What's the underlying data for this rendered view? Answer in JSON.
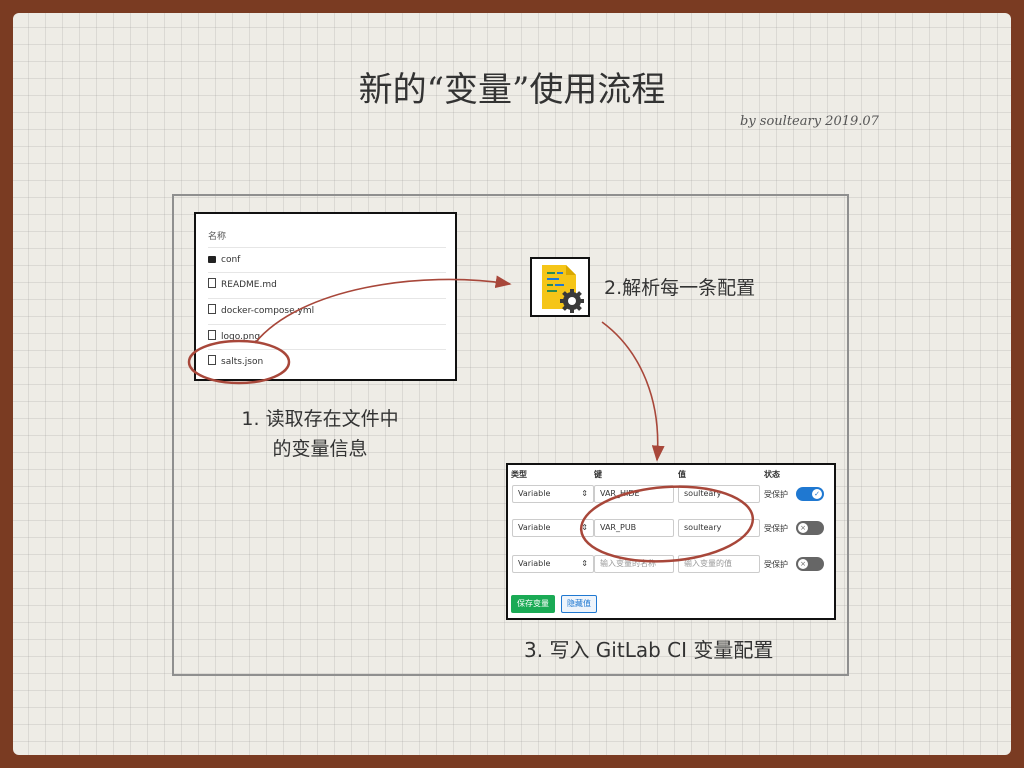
{
  "slide": {
    "title": "新的“变量”使用流程",
    "byline": "by soulteary 2019.07"
  },
  "files": {
    "header": "名称",
    "items": [
      {
        "name": "conf",
        "icon": "folder-icon"
      },
      {
        "name": "README.md",
        "icon": "file-icon"
      },
      {
        "name": "docker-compose.yml",
        "icon": "file-icon"
      },
      {
        "name": "logo.png",
        "icon": "file-icon"
      },
      {
        "name": "salts.json",
        "icon": "file-icon"
      }
    ]
  },
  "steps": {
    "step1_line1": "1. 读取存在文件中",
    "step1_line2": "的变量信息",
    "step2": "2.解析每一条配置",
    "step3": "3. 写入 GitLab CI 变量配置"
  },
  "variables": {
    "headers": {
      "type": "类型",
      "key": "键",
      "value": "值",
      "state": "状态"
    },
    "rows": [
      {
        "type": "Variable",
        "key": "VAR_HIDE",
        "value": "soulteary",
        "protected_label": "受保护",
        "protected": true
      },
      {
        "type": "Variable",
        "key": "VAR_PUB",
        "value": "soulteary",
        "protected_label": "受保护",
        "protected": false
      },
      {
        "type": "Variable",
        "key_placeholder": "输入变量的名称",
        "value_placeholder": "输入变量的值",
        "protected_label": "受保护",
        "protected": false
      }
    ],
    "save_label": "保存变量",
    "hide_label": "隐藏值"
  },
  "colors": {
    "annotation": "#a8473a",
    "toggle_on": "#1f78d1",
    "save_button": "#1aaa55"
  }
}
